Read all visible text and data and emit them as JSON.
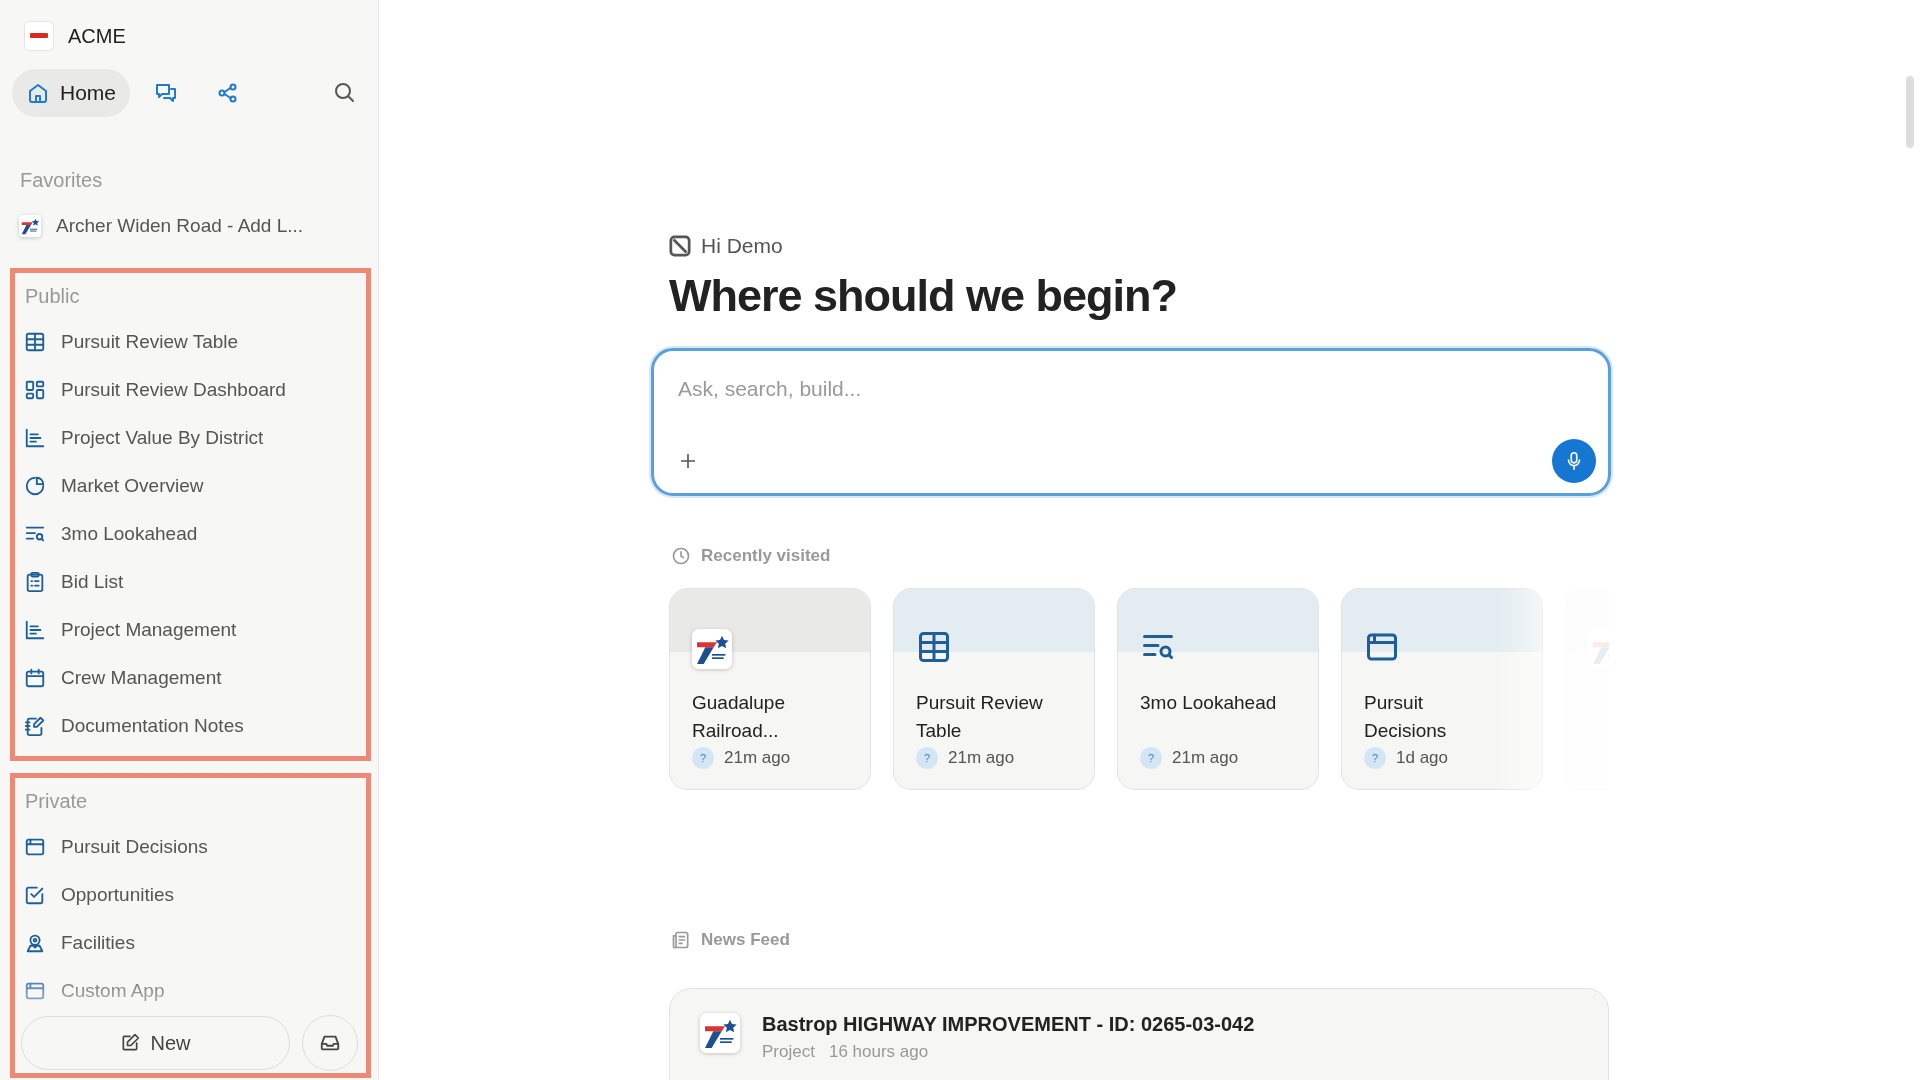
{
  "workspace": {
    "name": "ACME"
  },
  "nav": [
    {
      "label": "Home",
      "selected": true
    },
    {
      "selected": false
    },
    {
      "selected": false
    }
  ],
  "favorites": {
    "title": "Favorites",
    "items": [
      "Archer Widen Road - Add L..."
    ]
  },
  "public": {
    "title": "Public",
    "items": [
      "Pursuit Review Table",
      "Pursuit Review Dashboard",
      "Project Value By District",
      "Market Overview",
      "3mo Lookahead",
      "Bid List",
      "Project Management",
      "Crew Management",
      "Documentation Notes"
    ]
  },
  "private": {
    "title": "Private",
    "items": [
      "Pursuit Decisions",
      "Opportunities",
      "Facilities",
      "Custom App"
    ]
  },
  "new_button": "New",
  "greeting": "Hi Demo",
  "heading": "Where should we begin?",
  "prompt": {
    "placeholder": "Ask, search, build..."
  },
  "recent": {
    "title": "Recently visited",
    "cards": [
      {
        "kind": "project",
        "title": "Guadalupe Railroad...",
        "avatar": "?",
        "time": "21m ago"
      },
      {
        "kind": "app",
        "title": "Pursuit Review Table",
        "avatar": "?",
        "time": "21m ago"
      },
      {
        "kind": "app",
        "title": "3mo Lookahead",
        "avatar": "?",
        "time": "21m ago"
      },
      {
        "kind": "app",
        "title": "Pursuit Decisions",
        "avatar": "?",
        "time": "1d ago"
      },
      {
        "kind": "project"
      }
    ]
  },
  "news": {
    "title": "News Feed",
    "items": [
      {
        "title": "Bastrop HIGHWAY IMPROVEMENT - ID: 0265-03-042",
        "type": "Project",
        "time": "16 hours ago"
      }
    ]
  }
}
